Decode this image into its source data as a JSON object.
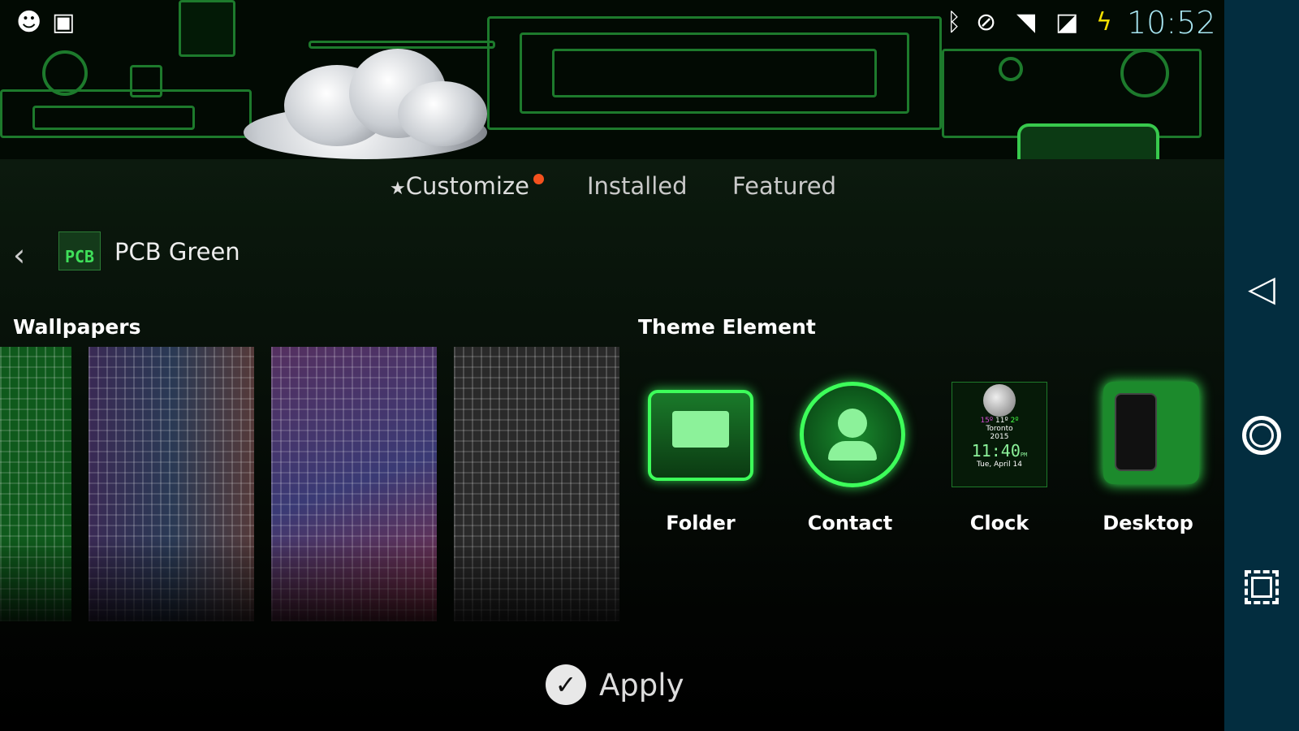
{
  "status_bar": {
    "left_icons": [
      "cyanogen-mascot-icon",
      "store-bag-icon"
    ],
    "right_icons": [
      "bluetooth-icon",
      "do-not-disturb-icon",
      "wifi-icon",
      "no-sim-icon",
      "battery-charging-icon"
    ],
    "time": "10:52",
    "time_color": "#a8e6f2"
  },
  "tabs": [
    {
      "label": "Customize",
      "icon": "star-icon",
      "active": true,
      "notification_dot": true
    },
    {
      "label": "Installed"
    },
    {
      "label": "Featured"
    }
  ],
  "header": {
    "back_icon": "chevron-left-icon",
    "theme_icon_text": "PCB",
    "title": "PCB Green"
  },
  "wallpapers": {
    "label": "Wallpapers",
    "items": [
      {
        "tint": "#1fa33a"
      },
      {
        "tint": "#6a4a9a"
      },
      {
        "tint": "#9a3a8a"
      },
      {
        "tint": "#6a6a6a"
      }
    ]
  },
  "theme_elements": {
    "label": "Theme Element",
    "items": [
      {
        "label": "Folder",
        "icon": "folder-icon"
      },
      {
        "label": "Contact",
        "icon": "contact-icon"
      },
      {
        "label": "Clock",
        "icon": "clock-widget-icon",
        "widget": {
          "temp_low": "15º",
          "temp": "11º",
          "temp_high": "2º",
          "city": "Toronto",
          "year": "2015",
          "time": "11:40",
          "ampm": "PM",
          "date": "Tue, April 14"
        }
      },
      {
        "label": "Desktop",
        "icon": "desktop-preview-icon"
      }
    ]
  },
  "apply": {
    "label": "Apply",
    "icon": "check-circle-icon"
  },
  "nav": {
    "buttons": [
      "back-triangle-icon",
      "home-circle-icon",
      "recents-chip-icon"
    ],
    "color": "#032d3f"
  },
  "accent": "#38c94d"
}
